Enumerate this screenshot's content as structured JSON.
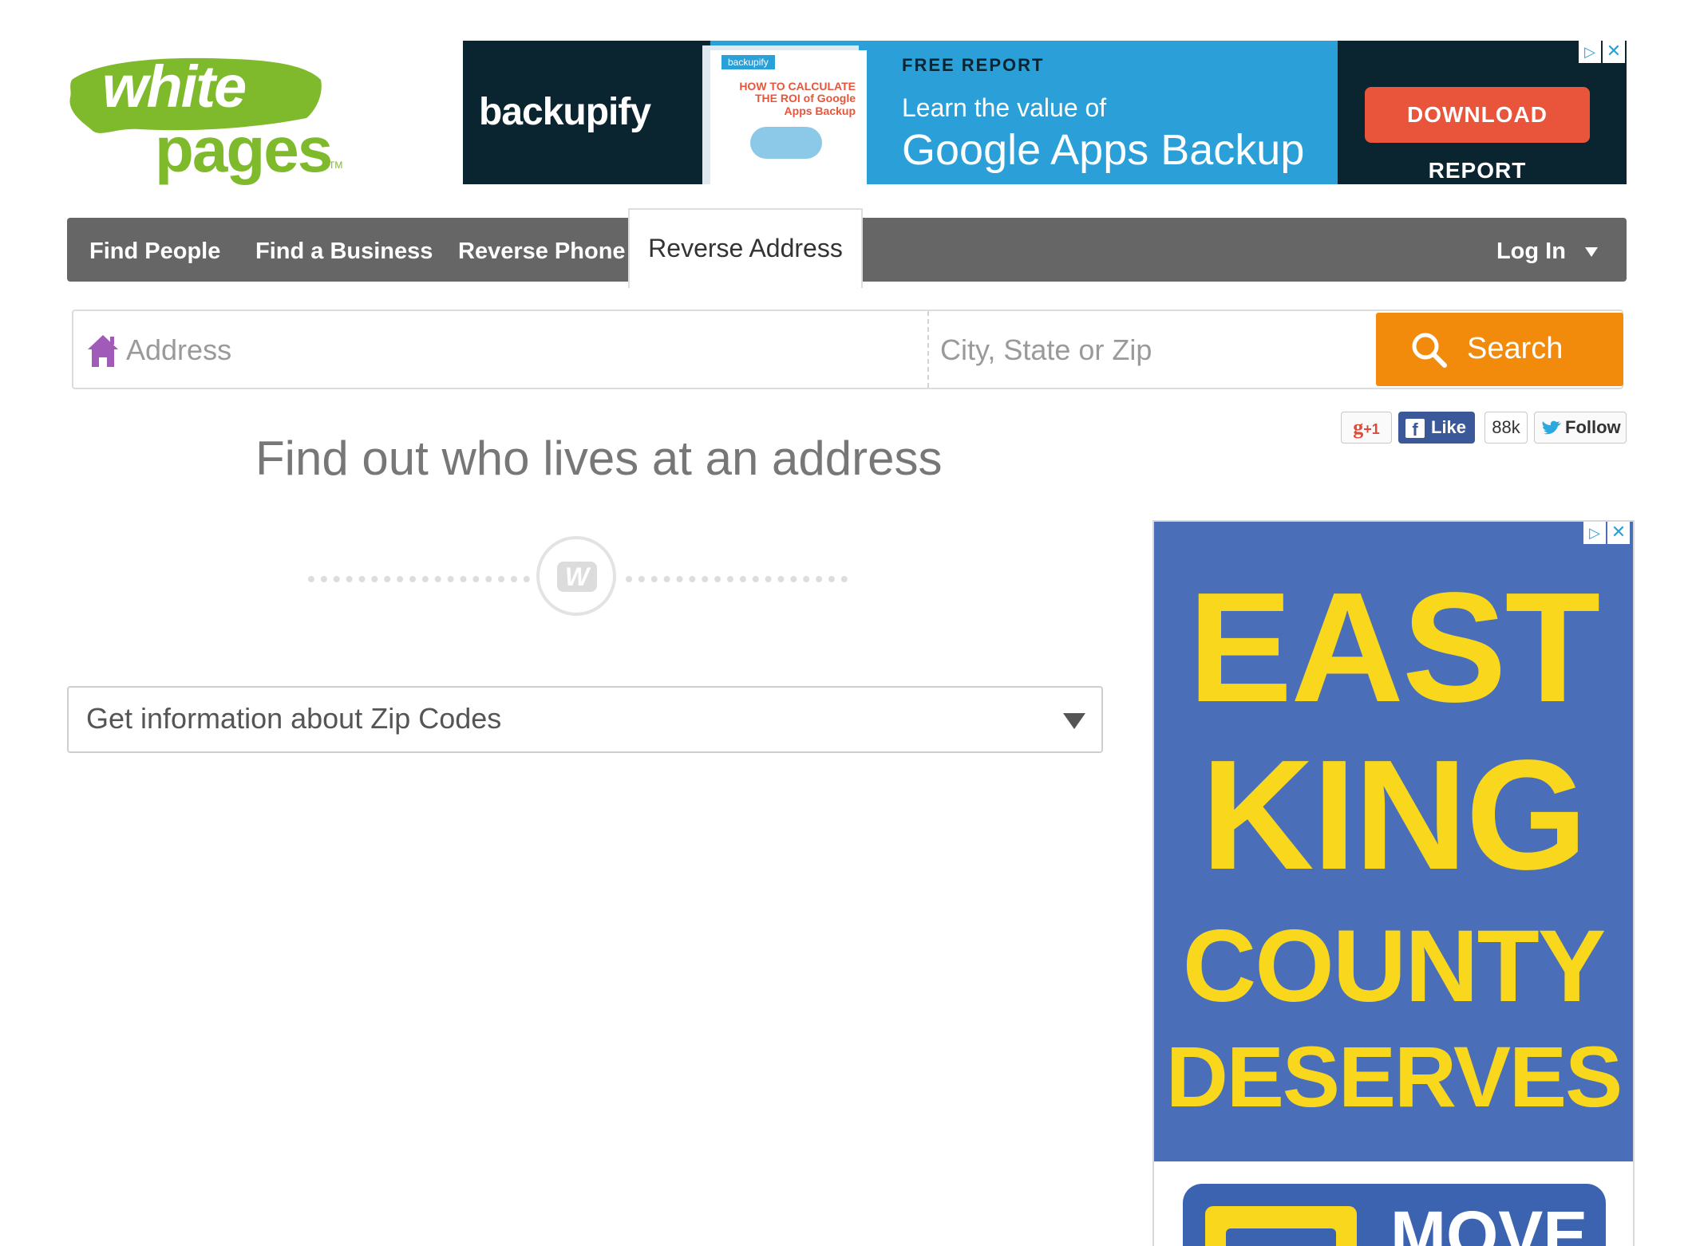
{
  "logo": {
    "line1": "white",
    "line2": "pages",
    "tm": "TM"
  },
  "ad_top": {
    "brand": "backupify",
    "doc_tag": "backupify",
    "doc_title": "HOW TO CALCULATE THE ROI of Google Apps Backup",
    "eyebrow": "FREE REPORT",
    "line1": "Learn the value of",
    "line2": "Google Apps Backup",
    "cta": "DOWNLOAD REPORT",
    "adchoices_icon": "adchoices-icon",
    "close_icon": "close-icon"
  },
  "nav": {
    "items": [
      {
        "label": "Find People"
      },
      {
        "label": "Find a Business"
      },
      {
        "label": "Reverse Phone"
      },
      {
        "label": "Reverse Address"
      }
    ],
    "active_index": 3,
    "login": "Log In",
    "login_icon": "chevron-down-icon"
  },
  "search": {
    "address_placeholder": "Address",
    "address_value": "",
    "city_placeholder": "City, State or Zip",
    "city_value": "",
    "button": "Search",
    "house_icon": "house-icon",
    "search_icon": "search-icon"
  },
  "social": {
    "gplus": "+1",
    "fb_like": "Like",
    "fb_count": "88k",
    "twitter": "Follow"
  },
  "headline": "Find out who lives at an address",
  "zip_dropdown": {
    "label": "Get information about Zip Codes"
  },
  "ad_side": {
    "lines": [
      "EAST",
      "KING",
      "COUNTY",
      "DESERVES"
    ],
    "cta": "MOVE"
  },
  "colors": {
    "brand_green": "#7fba2c",
    "nav_gray": "#666666",
    "search_orange": "#f28b0c",
    "house_purple": "#a05ab8",
    "ad_blue": "#2a9fd8",
    "side_ad_blue": "#4a6fb8",
    "side_ad_yellow": "#f9d71c"
  }
}
